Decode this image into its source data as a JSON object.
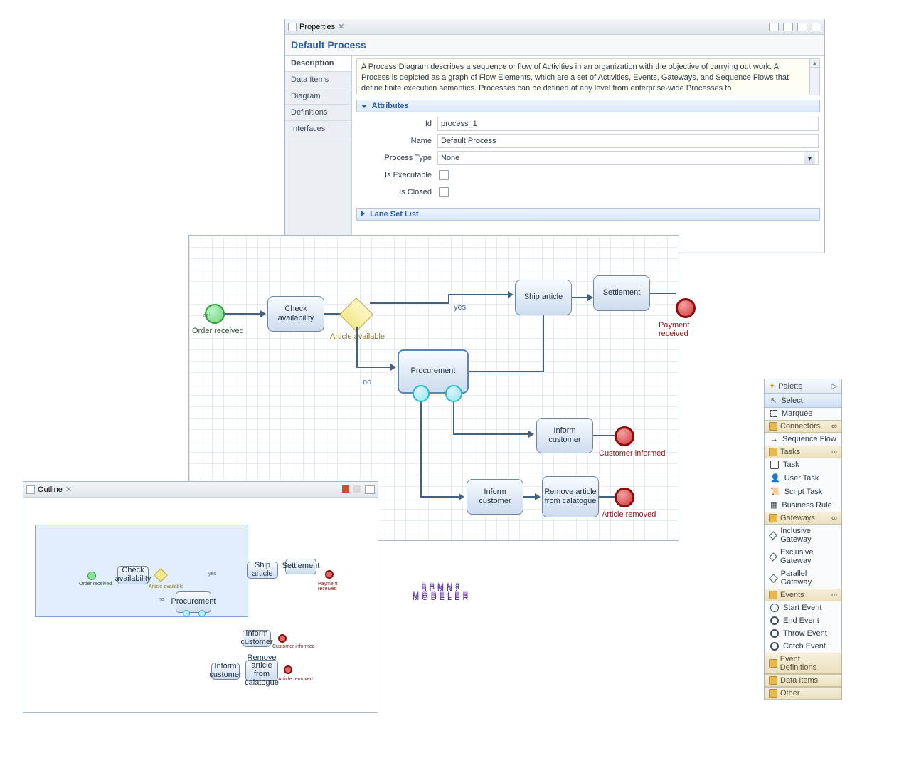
{
  "properties": {
    "panel_title": "Properties",
    "heading": "Default Process",
    "tabs": {
      "description": "Description",
      "dataitems": "Data Items",
      "diagram": "Diagram",
      "definitions": "Definitions",
      "interfaces": "Interfaces"
    },
    "description_text": "A Process Diagram describes a sequence or flow of Activities in an organization with the objective of carrying out work. A Process is depicted as a graph of Flow Elements, which are a set of Activities, Events, Gateways, and Sequence Flows that define finite execution semantics. Processes can be defined at any level from enterprise-wide Processes to",
    "sections": {
      "attributes_title": "Attributes",
      "lane_set_title": "Lane Set List"
    },
    "attributes": {
      "id_label": "Id",
      "id_value": "process_1",
      "name_label": "Name",
      "name_value": "Default Process",
      "process_type_label": "Process Type",
      "process_type_value": "None",
      "is_executable_label": "Is Executable",
      "is_executable_value": false,
      "is_closed_label": "Is Closed",
      "is_closed_value": false
    }
  },
  "diagram": {
    "start_label": "Order received",
    "nodes": {
      "check": "Check availability",
      "gateway_label": "Article available",
      "procurement": "Procurement",
      "ship": "Ship article",
      "settlement": "Settlement",
      "inform1": "Inform customer",
      "inform2": "Inform customer",
      "remove": "Remove article from calatogue"
    },
    "edge_labels": {
      "yes": "yes",
      "no": "no"
    },
    "end_labels": {
      "payment": "Payment received",
      "customer": "Customer informed",
      "article": "Article removed"
    }
  },
  "outline": {
    "panel_title": "Outline"
  },
  "palette": {
    "title": "Palette",
    "select": "Select",
    "marquee": "Marquee",
    "groups": {
      "connectors": "Connectors",
      "tasks": "Tasks",
      "gateways": "Gateways",
      "events": "Events",
      "eventdefs": "Event Definitions",
      "dataitems": "Data Items",
      "other": "Other"
    },
    "items": {
      "seqflow": "Sequence Flow",
      "task": "Task",
      "usertask": "User Task",
      "scripttask": "Script Task",
      "bizrule": "Business Rule",
      "inclgw": "Inclusive Gateway",
      "exclgw": "Exclusive Gateway",
      "parallelgw": "Parallel Gateway",
      "startev": "Start Event",
      "endev": "End Event",
      "throwev": "Throw Event",
      "catchev": "Catch Event"
    }
  },
  "logo": {
    "line1": "BPMN2",
    "line2": "MODELER"
  }
}
